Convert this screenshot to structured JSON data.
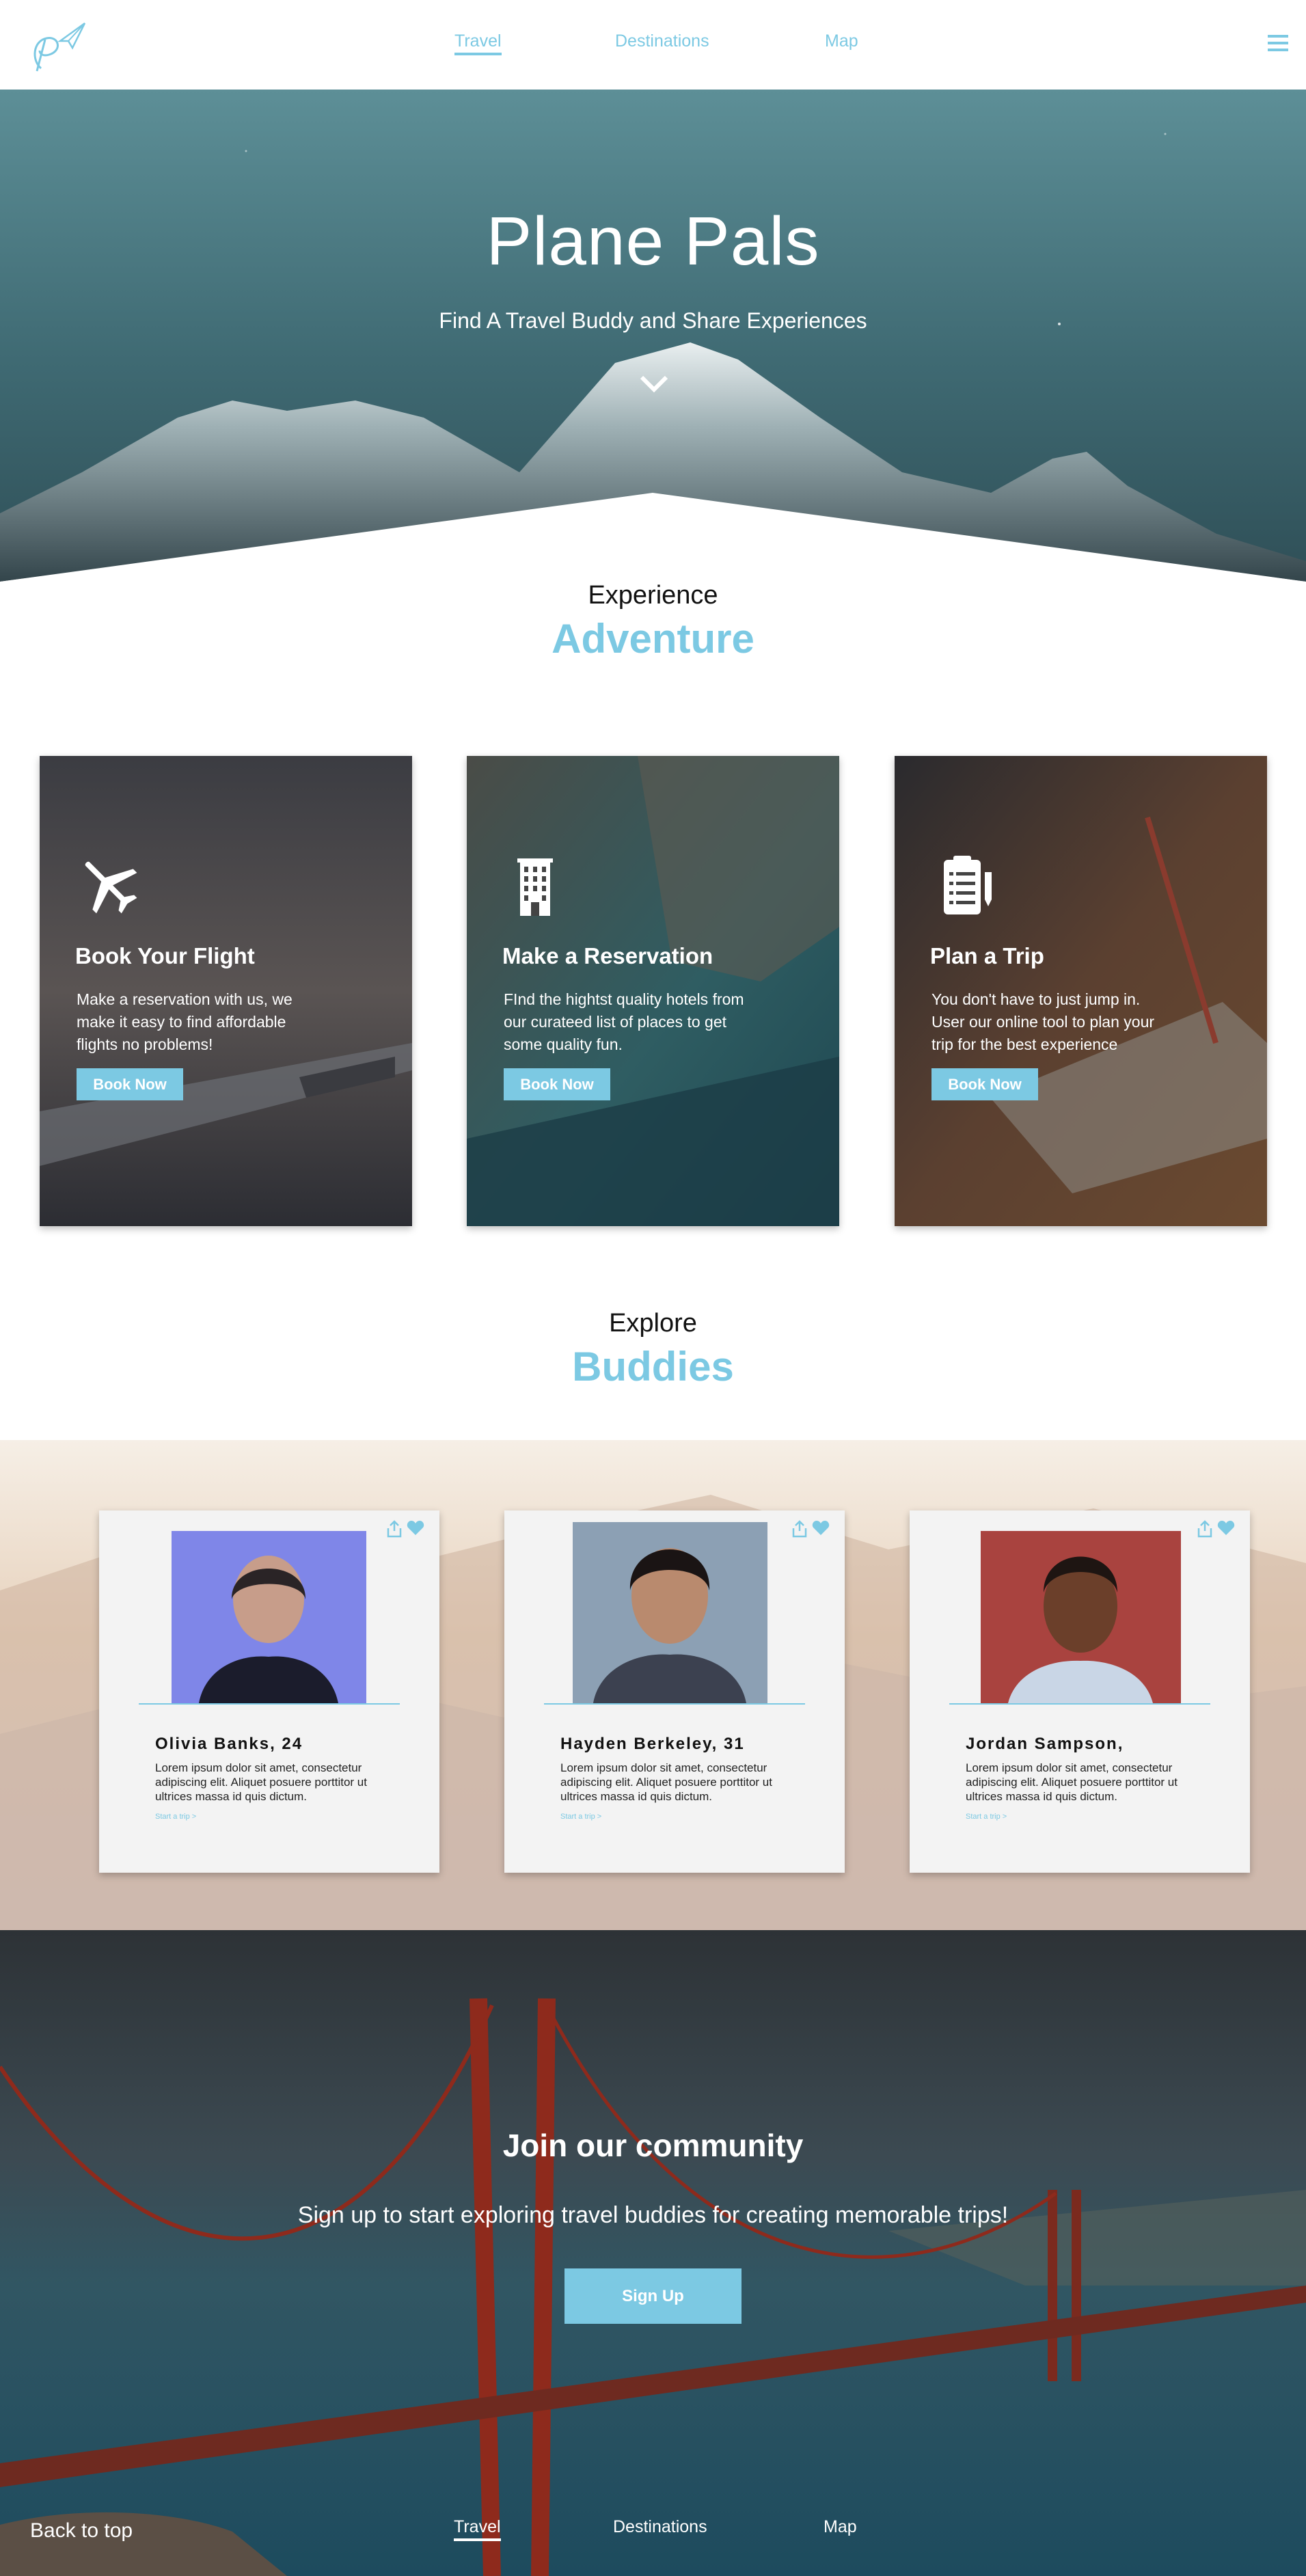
{
  "nav": {
    "items": [
      {
        "label": "Travel",
        "active": true
      },
      {
        "label": "Destinations",
        "active": false
      },
      {
        "label": "Map",
        "active": false
      }
    ],
    "logo_icon": "paper-plane-p-logo",
    "menu_icon": "hamburger-menu-icon"
  },
  "hero": {
    "title": "Plane Pals",
    "subtitle": "Find A Travel Buddy and Share Experiences",
    "scroll_icon": "chevron-down-icon"
  },
  "experience": {
    "kicker": "Experience",
    "title": "Adventure"
  },
  "services": [
    {
      "icon": "airplane-icon",
      "title": "Book Your Flight",
      "text": "Make a reservation with us, we make it easy to find affordable flights no problems!",
      "button": "Book Now"
    },
    {
      "icon": "hotel-building-icon",
      "title": "Make a Reservation",
      "text": "FInd the hightst quality hotels from our curateed list of places to get some quality fun.",
      "button": "Book Now"
    },
    {
      "icon": "clipboard-list-icon",
      "title": "Plan a Trip",
      "text": "You don't have to just jump in. User our online tool to plan your trip for the best experience",
      "button": "Book Now"
    }
  ],
  "explore": {
    "kicker": "Explore",
    "title": "Buddies"
  },
  "buddies": [
    {
      "name": "Olivia Banks, 24",
      "text": "Lorem ipsum dolor sit amet, consectetur adipiscing elit. Aliquet posuere porttitor ut ultrices massa id quis dictum.",
      "link": "Start a trip >"
    },
    {
      "name": "Hayden Berkeley, 31",
      "text": "Lorem ipsum dolor sit amet, consectetur adipiscing elit. Aliquet posuere porttitor ut ultrices massa id quis dictum.",
      "link": "Start a trip >"
    },
    {
      "name": "Jordan Sampson,",
      "text": "Lorem ipsum dolor sit amet, consectetur adipiscing elit. Aliquet posuere porttitor ut ultrices massa id quis dictum.",
      "link": "Start a trip >"
    }
  ],
  "community": {
    "title": "Join our community",
    "subtitle": "Sign up to start exploring travel buddies for creating memorable trips!",
    "button": "Sign Up"
  },
  "footer": {
    "back_to_top": "Back to top",
    "items": [
      {
        "label": "Travel",
        "active": true
      },
      {
        "label": "Destinations",
        "active": false
      },
      {
        "label": "Map",
        "active": false
      }
    ]
  },
  "colors": {
    "accent": "#7cc9e3",
    "text_dark": "#111111",
    "card_bg": "#f3f3f3"
  }
}
